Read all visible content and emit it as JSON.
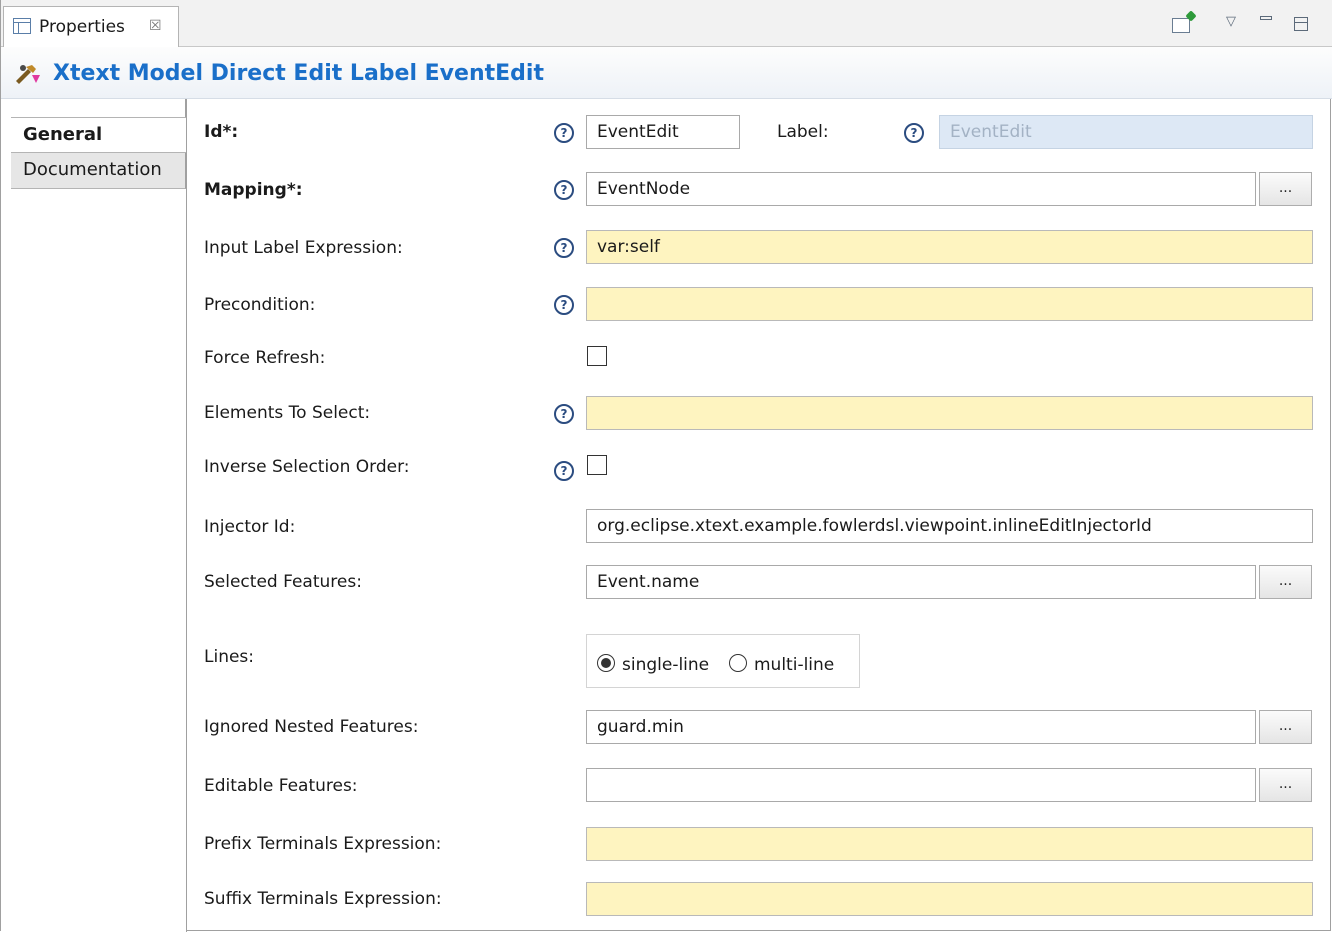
{
  "tab": {
    "label": "Properties",
    "close": "☒"
  },
  "toolbar": {
    "menu": "▽"
  },
  "title": "Xtext Model Direct Edit Label EventEdit",
  "sidebar": {
    "items": [
      {
        "label": "General"
      },
      {
        "label": "Documentation"
      }
    ]
  },
  "help_glyph": "?",
  "browse_label": "...",
  "form": {
    "id": {
      "label": "Id*:",
      "value": "EventEdit"
    },
    "label_field": {
      "label": "Label:",
      "value": "EventEdit"
    },
    "mapping": {
      "label": "Mapping*:",
      "value": "EventNode"
    },
    "input_label_expression": {
      "label": "Input Label Expression:",
      "value": "var:self"
    },
    "precondition": {
      "label": "Precondition:",
      "value": ""
    },
    "force_refresh": {
      "label": "Force Refresh:",
      "checked": false
    },
    "elements_to_select": {
      "label": "Elements To Select:",
      "value": ""
    },
    "inverse_selection_order": {
      "label": "Inverse Selection Order:",
      "checked": false
    },
    "injector_id": {
      "label": "Injector Id:",
      "value": "org.eclipse.xtext.example.fowlerdsl.viewpoint.inlineEditInjectorId"
    },
    "selected_features": {
      "label": "Selected Features:",
      "value": "Event.name"
    },
    "lines": {
      "label": "Lines:",
      "options": [
        {
          "label": "single-line",
          "selected": true
        },
        {
          "label": "multi-line",
          "selected": false
        }
      ]
    },
    "ignored_nested_features": {
      "label": "Ignored Nested Features:",
      "value": "guard.min"
    },
    "editable_features": {
      "label": "Editable Features:",
      "value": ""
    },
    "prefix_terminals_expression": {
      "label": "Prefix Terminals Expression:",
      "value": ""
    },
    "suffix_terminals_expression": {
      "label": "Suffix Terminals Expression:",
      "value": ""
    }
  },
  "colors": {
    "accent": "#1a6fc9",
    "required_bg": "#fef4c0",
    "disabled_bg": "#dde8f5",
    "help": "#2b4c80"
  }
}
